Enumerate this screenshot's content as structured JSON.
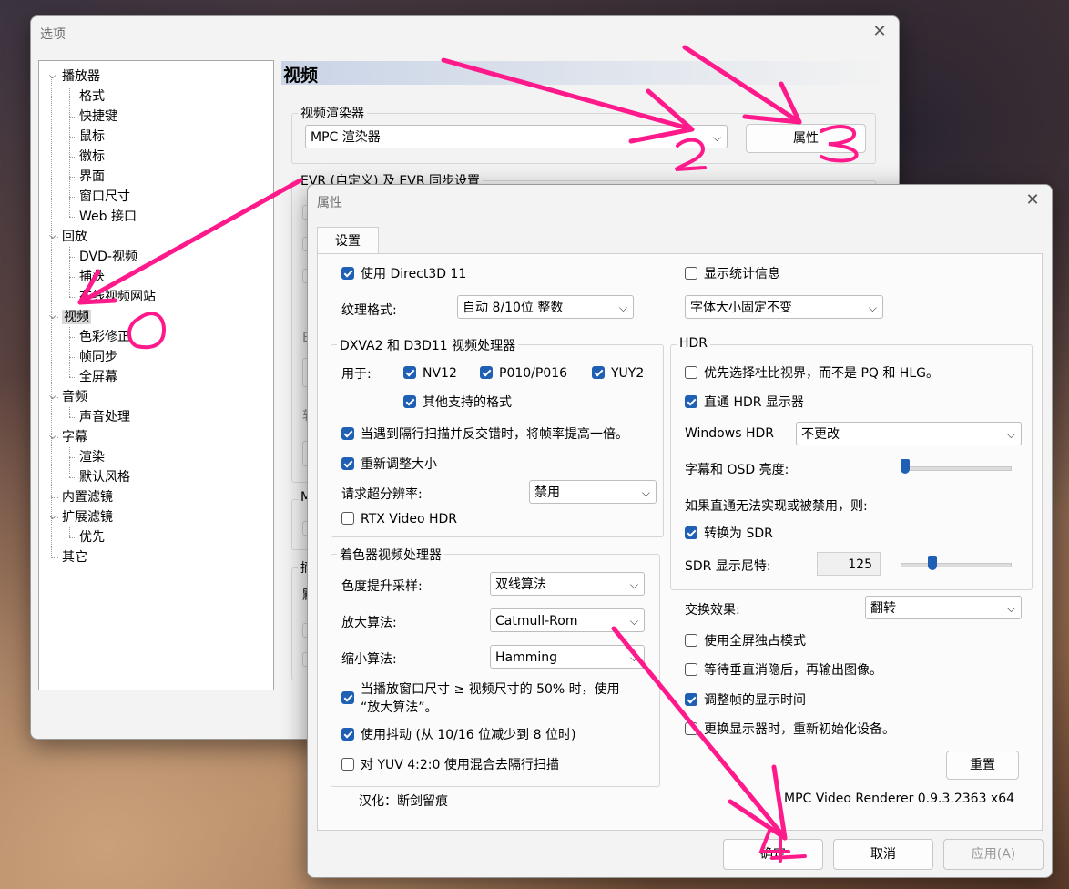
{
  "options_window": {
    "title": "选项",
    "tree": [
      {
        "label": "播放器",
        "level": 0,
        "expanded": true
      },
      {
        "label": "格式",
        "level": 1
      },
      {
        "label": "快捷键",
        "level": 1
      },
      {
        "label": "鼠标",
        "level": 1
      },
      {
        "label": "徽标",
        "level": 1
      },
      {
        "label": "界面",
        "level": 1
      },
      {
        "label": "窗口尺寸",
        "level": 1
      },
      {
        "label": "Web 接口",
        "level": 1
      },
      {
        "label": "回放",
        "level": 0,
        "expanded": true
      },
      {
        "label": "DVD-视频",
        "level": 1
      },
      {
        "label": "捕获",
        "level": 1
      },
      {
        "label": "在线视频网站",
        "level": 1
      },
      {
        "label": "视频",
        "level": 0,
        "expanded": true,
        "selected": true
      },
      {
        "label": "色彩修正",
        "level": 1
      },
      {
        "label": "帧同步",
        "level": 1
      },
      {
        "label": "全屏幕",
        "level": 1
      },
      {
        "label": "音频",
        "level": 0,
        "expanded": true
      },
      {
        "label": "声音处理",
        "level": 1
      },
      {
        "label": "字幕",
        "level": 0,
        "expanded": true
      },
      {
        "label": "渲染",
        "level": 1
      },
      {
        "label": "默认风格",
        "level": 1
      },
      {
        "label": "内置滤镜",
        "level": 0
      },
      {
        "label": "扩展滤镜",
        "level": 0,
        "expanded": true
      },
      {
        "label": "优先",
        "level": 1
      },
      {
        "label": "其它",
        "level": 0
      }
    ],
    "page_title": "视频",
    "renderer_group": "视频渲染器",
    "renderer_value": "MPC 渲染器",
    "properties_button": "属性",
    "evr_group": "EVR (自定义) 及 EVR 同步设置",
    "partial": {
      "m": "M",
      "e": "E",
      "sl": "软",
      "t": "摘",
      "m2": "默"
    }
  },
  "properties_dialog": {
    "title": "属性",
    "tab": "设置",
    "left": {
      "use_d3d11": {
        "label": "使用 Direct3D 11",
        "checked": true
      },
      "texture_label": "纹理格式:",
      "texture_value": "自动 8/10位 整数",
      "dxva_group": "DXVA2 和 D3D11 视频处理器",
      "used_for": "用于:",
      "nv12": {
        "label": "NV12",
        "checked": true
      },
      "p010": {
        "label": "P010/P016",
        "checked": true
      },
      "yuy2": {
        "label": "YUY2",
        "checked": true
      },
      "other_formats": {
        "label": "其他支持的格式",
        "checked": true
      },
      "double_framerate": {
        "label": "当遇到隔行扫描并反交错时，将帧率提高一倍。",
        "checked": true
      },
      "resize": {
        "label": "重新调整大小",
        "checked": true
      },
      "super_res_label": "请求超分辨率:",
      "super_res_value": "禁用",
      "rtx_hdr": {
        "label": "RTX Video HDR",
        "checked": false
      },
      "shader_group": "着色器视频处理器",
      "chroma_label": "色度提升采样:",
      "chroma_value": "双线算法",
      "upscale_label": "放大算法:",
      "upscale_value": "Catmull-Rom",
      "downscale_label": "缩小算法:",
      "downscale_value": "Hamming",
      "upscale_when_line1": "当播放窗口尺寸 ≥ 视频尺寸的 50% 时，使用",
      "upscale_when_line2": "“放大算法”。",
      "upscale_when_checked": true,
      "dither": {
        "label": "使用抖动 (从 10/16 位减少到 8 位时)",
        "checked": true
      },
      "blend_deint": {
        "label": "对 YUV 4:2:0 使用混合去隔行扫描",
        "checked": false
      }
    },
    "right": {
      "show_stats": {
        "label": "显示统计信息",
        "checked": false
      },
      "font_size_value": "字体大小固定不变",
      "hdr_group": "HDR",
      "prefer_dolby": {
        "label": "优先选择杜比视界，而不是 PQ 和 HLG。",
        "checked": false
      },
      "hdr_passthrough": {
        "label": "直通 HDR 显示器",
        "checked": true
      },
      "windows_hdr_label": "Windows HDR",
      "windows_hdr_value": "不更改",
      "osd_brightness_label": "字幕和 OSD 亮度:",
      "osd_brightness_level": 0.04,
      "fallback_text": "如果直通无法实现或被禁用，则:",
      "convert_sdr": {
        "label": "转换为 SDR",
        "checked": true
      },
      "sdr_nits_label": "SDR 显示尼特:",
      "sdr_nits_value": "125",
      "sdr_nits_level": 0.29,
      "swap_label": "交换效果:",
      "swap_value": "翻转",
      "exclusive_fs": {
        "label": "使用全屏独占模式",
        "checked": false
      },
      "wait_vblank": {
        "label": "等待垂直消隐后，再输出图像。",
        "checked": false
      },
      "adjust_frame_time": {
        "label": "调整帧的显示时间",
        "checked": true
      },
      "reinit_display": {
        "label": "更换显示器时，重新初始化设备。",
        "checked": false
      },
      "reset_button": "重置"
    },
    "localization": "汉化：断剑留痕",
    "version": "MPC Video Renderer 0.9.3.2363 x64",
    "ok_button": "确定",
    "cancel_button": "取消",
    "apply_button": "应用(A)"
  },
  "annotations": {
    "color": "#ff1a8c",
    "labels": [
      "1",
      "2",
      "3",
      "4"
    ]
  }
}
